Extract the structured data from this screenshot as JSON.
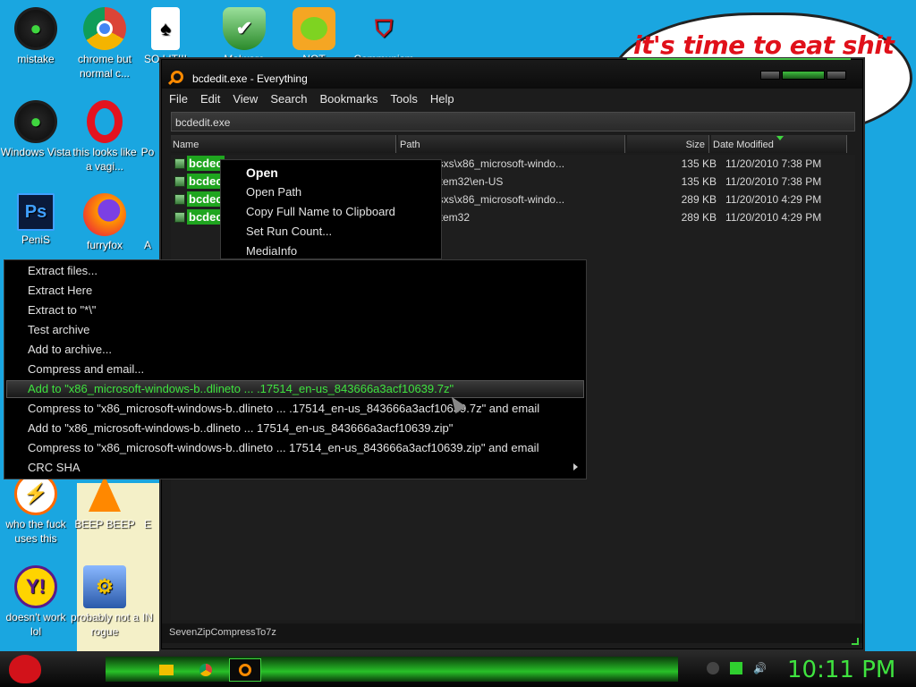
{
  "desktop": {
    "bubble_text": "it's time to eat shit",
    "icons": [
      {
        "label": "mistake",
        "icon": "razer-icon"
      },
      {
        "label": "chrome but normal c...",
        "icon": "chrome-icon"
      },
      {
        "label": "SO LIT!!!",
        "icon": "solitaire-icon"
      },
      {
        "label": "Malware",
        "icon": "shield-icon"
      },
      {
        "label": "NOT",
        "icon": "angry-pig-icon"
      },
      {
        "label": "Communism",
        "icon": "emblem-icon"
      },
      {
        "label": "Windows Vista",
        "icon": "razer-icon"
      },
      {
        "label": "this looks like a vagi...",
        "icon": "opera-icon"
      },
      {
        "label": "Po",
        "icon": "generic-icon"
      },
      {
        "label": "PeniS",
        "icon": "photoshop-icon"
      },
      {
        "label": "furryfox",
        "icon": "firefox-icon"
      },
      {
        "label": "A",
        "icon": "generic-icon"
      },
      {
        "label": "who the fuck uses this",
        "icon": "lightning-icon"
      },
      {
        "label": "BEEP BEEP",
        "icon": "vlc-icon"
      },
      {
        "label": "E",
        "icon": "generic-icon"
      },
      {
        "label": "doesn't work lol",
        "icon": "yahoo-messenger-icon"
      },
      {
        "label": "probably not a rogue",
        "icon": "gears-icon"
      },
      {
        "label": "IN",
        "icon": "generic-icon"
      }
    ]
  },
  "window": {
    "title": "bcdedit.exe - Everything",
    "menu": [
      "File",
      "Edit",
      "View",
      "Search",
      "Bookmarks",
      "Tools",
      "Help"
    ],
    "search_value": "bcdedit.exe",
    "columns": {
      "name": "Name",
      "path": "Path",
      "size": "Size",
      "date": "Date Modified"
    },
    "rows": [
      {
        "name": "bcdec",
        "path": "ows\\winsxs\\x86_microsoft-windo...",
        "size": "135 KB",
        "date": "11/20/2010 7:38 PM"
      },
      {
        "name": "bcdec",
        "path": "ows\\System32\\en-US",
        "size": "135 KB",
        "date": "11/20/2010 7:38 PM"
      },
      {
        "name": "bcdec",
        "path": "ows\\winsxs\\x86_microsoft-windo...",
        "size": "289 KB",
        "date": "11/20/2010 4:29 PM"
      },
      {
        "name": "bcdec",
        "path": "ows\\System32",
        "size": "289 KB",
        "date": "11/20/2010 4:29 PM"
      }
    ],
    "status": "SevenZipCompressTo7z"
  },
  "context_menu_1": [
    "Open",
    "Open Path",
    "Copy Full Name to Clipboard",
    "Set Run Count...",
    "MediaInfo"
  ],
  "context_menu_2": [
    "Extract files...",
    "Extract Here",
    "Extract to \"*\\\"",
    "Test archive",
    "Add to archive...",
    "Compress and email...",
    "Add to \"x86_microsoft-windows-b..dlineto ... .17514_en-us_843666a3acf10639.7z\"",
    "Compress to \"x86_microsoft-windows-b..dlineto ... .17514_en-us_843666a3acf10639.7z\" and email",
    "Add to \"x86_microsoft-windows-b..dlineto ... 17514_en-us_843666a3acf10639.zip\"",
    "Compress to \"x86_microsoft-windows-b..dlineto ... 17514_en-us_843666a3acf10639.zip\" and email",
    "CRC SHA"
  ],
  "taskbar": {
    "clock": "10:11 PM"
  }
}
